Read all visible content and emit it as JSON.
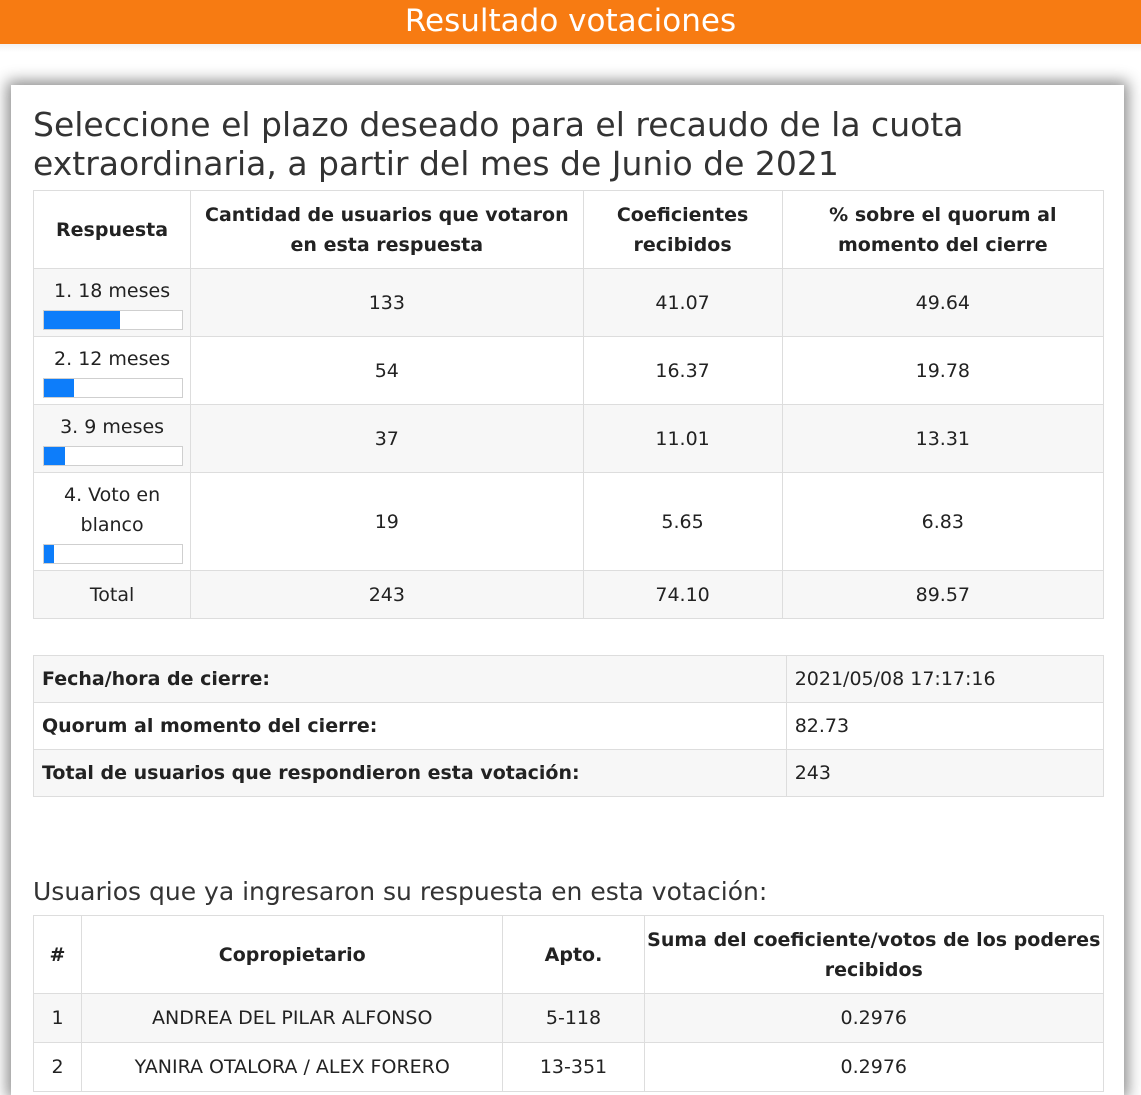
{
  "header": {
    "title": "Resultado votaciones"
  },
  "question": {
    "title": "Seleccione el plazo deseado para el recaudo de la cuota extraordinaria, a partir del mes de Junio de 2021",
    "columns": [
      "Respuesta",
      "Cantidad de usuarios que votaron en esta respuesta",
      "Coeficientes recibidos",
      "% sobre el quorum al momento del cierre"
    ],
    "rows": [
      {
        "label": "1. 18 meses",
        "users": "133",
        "coef": "41.07",
        "pct": "49.64",
        "bar_pct": 55
      },
      {
        "label": "2. 12 meses",
        "users": "54",
        "coef": "16.37",
        "pct": "19.78",
        "bar_pct": 22
      },
      {
        "label": "3. 9 meses",
        "users": "37",
        "coef": "11.01",
        "pct": "13.31",
        "bar_pct": 15
      },
      {
        "label": "4. Voto en blanco",
        "users": "19",
        "coef": "5.65",
        "pct": "6.83",
        "bar_pct": 7
      }
    ],
    "total": {
      "label": "Total",
      "users": "243",
      "coef": "74.10",
      "pct": "89.57"
    }
  },
  "summary": {
    "rows": [
      {
        "label": "Fecha/hora de cierre:",
        "value": "2021/05/08 17:17:16"
      },
      {
        "label": "Quorum al momento del cierre:",
        "value": "82.73"
      },
      {
        "label": "Total de usuarios que respondieron esta votación:",
        "value": "243"
      }
    ]
  },
  "voters": {
    "title": "Usuarios que ya ingresaron su respuesta en esta votación:",
    "columns": [
      "#",
      "Copropietario",
      "Apto.",
      "Suma del coeficiente/votos de los poderes recibidos"
    ],
    "rows": [
      {
        "num": "1",
        "name": "ANDREA DEL PILAR ALFONSO",
        "apto": "5-118",
        "sum": "0.2976"
      },
      {
        "num": "2",
        "name": "YANIRA OTALORA / ALEX FORERO",
        "apto": "13-351",
        "sum": "0.2976"
      }
    ]
  },
  "colors": {
    "header_bg": "#f77b12",
    "bar_fill": "#0d7dfa",
    "row_alt": "#f7f7f7"
  }
}
